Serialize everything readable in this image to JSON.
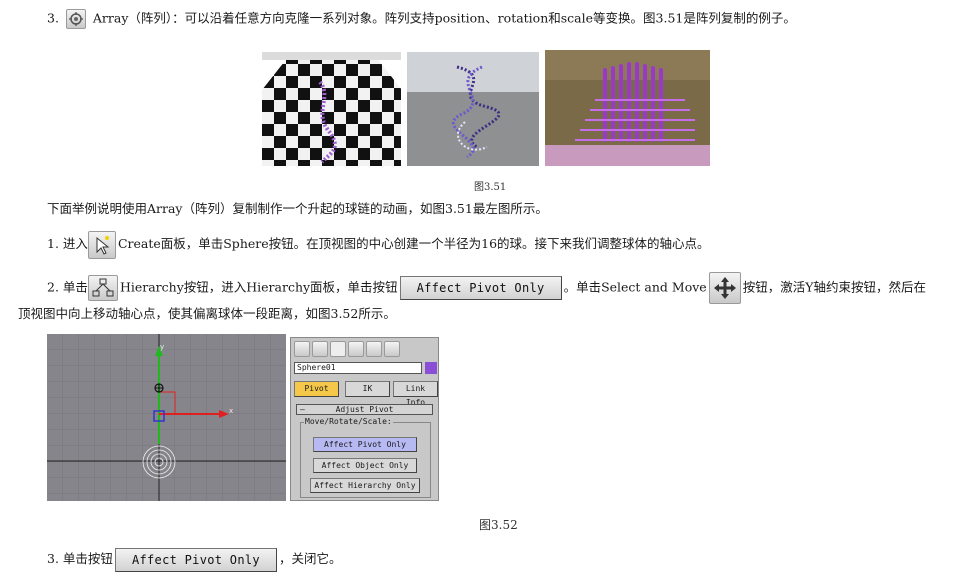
{
  "step3": {
    "number": "3.",
    "text": "Array（阵列）：可以沿着任意方向克隆一系列对象。阵列支持position、rotation和scale等变换。图3.51是阵列复制的例子。"
  },
  "fig351": {
    "caption": "图3.51"
  },
  "intro": {
    "text": "下面举例说明使用Array（阵列）复制制作一个升起的球链的动画，如图3.51最左图所示。"
  },
  "step1": {
    "number": "1.",
    "text_before": "进入",
    "text_after": "Create面板，单击Sphere按钮。在顶视图的中心创建一个半径为16的球。接下来我们调整球体的轴心点。"
  },
  "step2": {
    "number": "2.",
    "text_a": "单击",
    "text_b": "Hierarchy按钮，进入Hierarchy面板，单击按钮",
    "button_label": "Affect Pivot Only",
    "text_c": "。单击Select and Move",
    "text_d": "按钮，激活Y轴约束按钮，然后在",
    "line2": "顶视图中向上移动轴心点，使其偏离球体一段距离，如图3.52所示。"
  },
  "viewport": {
    "axis_y": "y",
    "axis_x": "x"
  },
  "hierarchy_panel": {
    "object_name": "Sphere01",
    "tabs": [
      "Pivot",
      "IK",
      "Link Info"
    ],
    "rollout_title": "Adjust Pivot",
    "group_label": "Move/Rotate/Scale:",
    "buttons": [
      "Affect Pivot Only",
      "Affect Object Only",
      "Affect Hierarchy Only"
    ]
  },
  "fig352": {
    "caption": "图3.52"
  },
  "step3b": {
    "number": "3.",
    "text_before": "单击按钮",
    "button_label": "Affect Pivot Only",
    "text_after": "，关闭它。"
  },
  "colors": {
    "viewport_bg": "#87858c",
    "panel_bg": "#c8c8c8",
    "pivot_tab_active": "#f5c84a",
    "selected_button": "#b7b9f2",
    "purple_swatch": "#8a4fd6",
    "axis_green": "#1fb81f",
    "axis_red": "#e02020"
  },
  "icons": [
    "array-icon",
    "create-cursor-icon",
    "hierarchy-icon",
    "select-move-icon"
  ]
}
